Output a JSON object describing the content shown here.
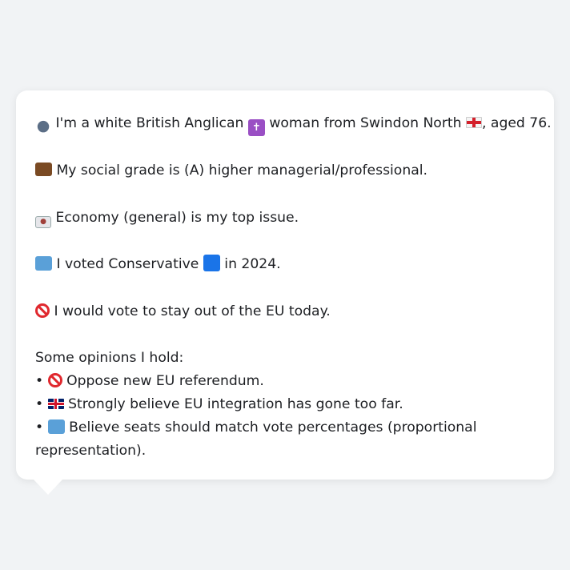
{
  "profile": {
    "identity": {
      "icon": "person-silhouette-icon",
      "text_a": "I'm a white British Anglican",
      "icon_religion": "latin-cross-icon",
      "text_b": "woman from Swindon North",
      "icon_flag": "england-flag-icon",
      "text_c": ", aged 76."
    },
    "social_grade": {
      "icon": "briefcase-icon",
      "text": "My social grade is (A) higher managerial/professional."
    },
    "top_issue": {
      "icon": "money-banknote-icon",
      "text": "Economy (general) is my top issue."
    },
    "vote_2024": {
      "icon": "ballot-box-icon",
      "text_a": "I voted Conservative",
      "icon_party": "blue-square-icon",
      "text_b": "in 2024."
    },
    "eu_vote": {
      "icon": "no-entry-icon",
      "text": "I would vote to stay out of the EU today."
    },
    "opinions": {
      "heading": "Some opinions I hold:",
      "bullet": "•",
      "items": [
        {
          "icon": "no-entry-icon",
          "text": "Oppose new EU referendum."
        },
        {
          "icon": "uk-flag-icon",
          "text": "Strongly believe EU integration has gone too far."
        },
        {
          "icon": "ballot-box-icon",
          "text": "Believe seats should match vote percentages (proportional representation)."
        }
      ]
    }
  },
  "colors": {
    "background": "#f1f3f5",
    "bubble": "#ffffff",
    "text": "#1d1f23"
  }
}
